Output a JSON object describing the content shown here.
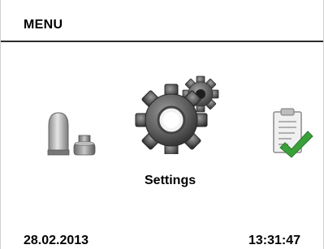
{
  "header": {
    "title": "MENU"
  },
  "carousel": {
    "items": [
      {
        "icon": "filter-cartridge-icon",
        "selected": false
      },
      {
        "icon": "settings-gear-icon",
        "selected": true,
        "label": "Settings"
      },
      {
        "icon": "checklist-clipboard-icon",
        "selected": false
      }
    ]
  },
  "footer": {
    "date": "28.02.2013",
    "time": "13:31:47"
  },
  "colors": {
    "background": "#ffffff",
    "text": "#000000",
    "divider": "#2b2b2b",
    "check": "#3aa03a"
  }
}
